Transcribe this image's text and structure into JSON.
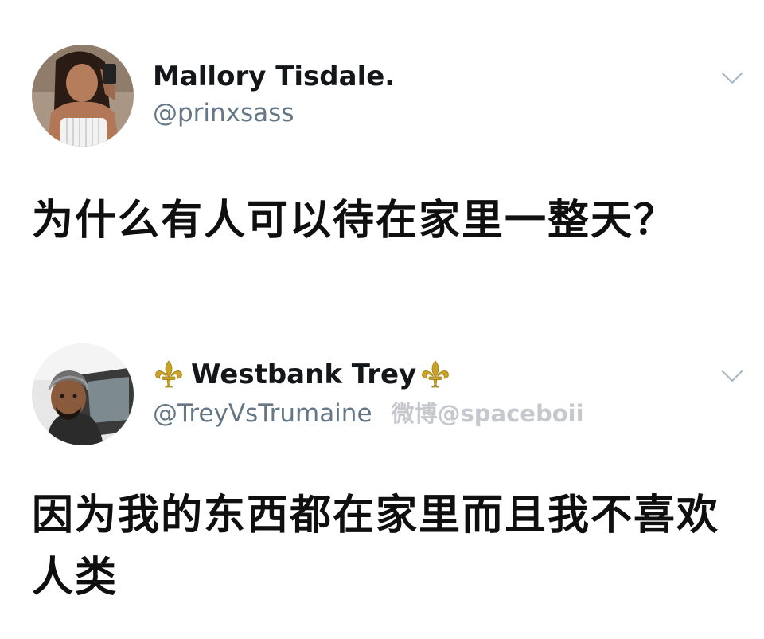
{
  "tweets": [
    {
      "display_name": "Mallory Tisdale.",
      "handle": "@prinxsass",
      "text": "为什么有人可以待在家里一整天？",
      "chevron_icon": "chevron-down-icon",
      "avatar_icon": "avatar"
    },
    {
      "display_name": "Westbank Trey",
      "name_decoration_icon": "fleur-de-lis-icon",
      "handle": "@TreyVsTrumaine",
      "watermark": "微博@spaceboii",
      "text": "因为我的东西都在家里而且我不喜欢人类",
      "chevron_icon": "chevron-down-icon",
      "avatar_icon": "avatar"
    }
  ],
  "colors": {
    "name": "#14171a",
    "handle": "#657786",
    "body_text": "#0f0f0f",
    "watermark": "#c5c9cd",
    "fleur_gold": "#c9a227",
    "chevron": "#aab8c2"
  }
}
